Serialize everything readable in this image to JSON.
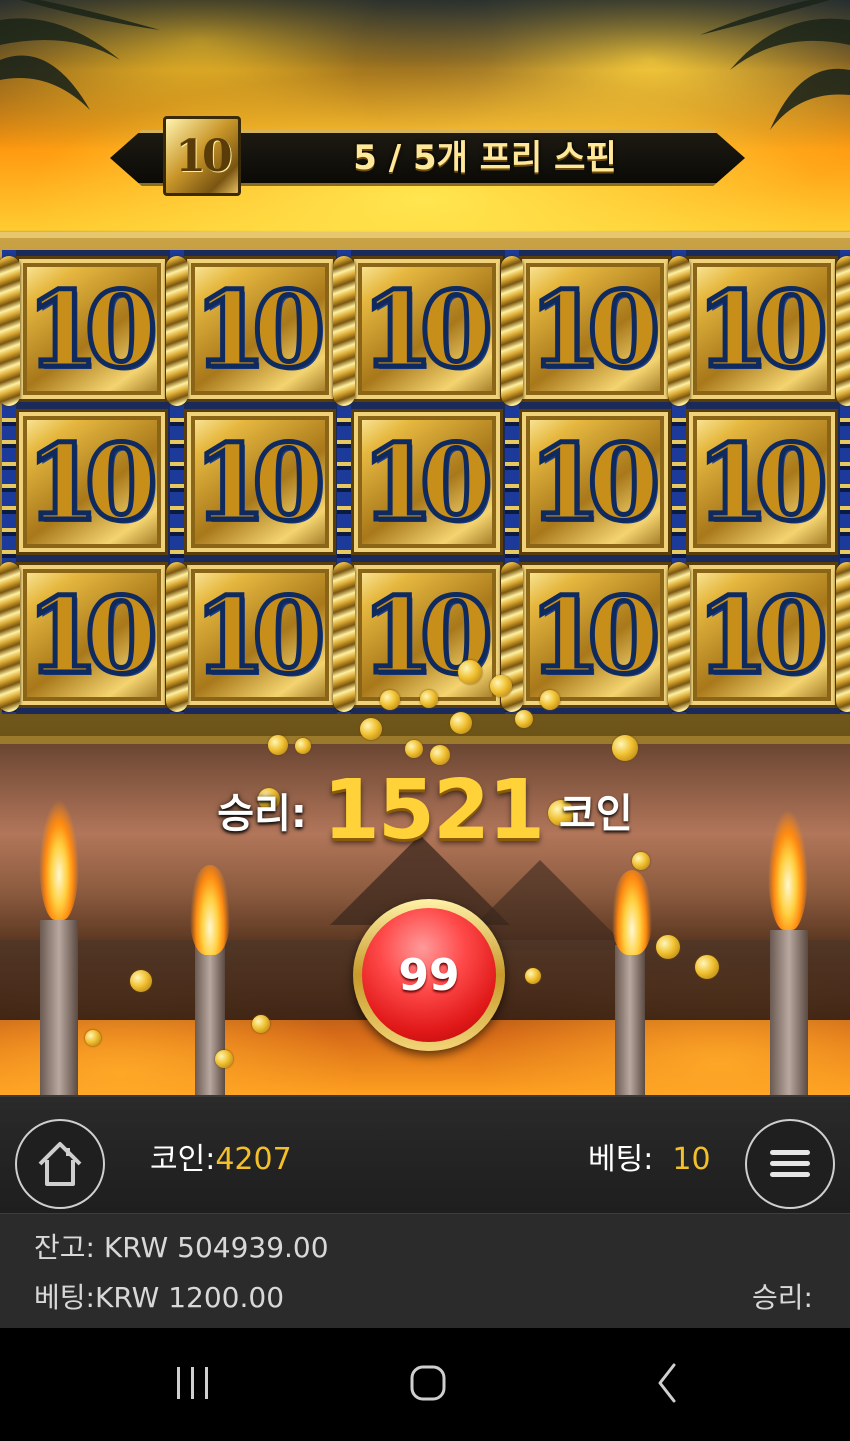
{
  "header": {
    "badge": "10",
    "free_spins": "5 / 5개 프리 스핀"
  },
  "reels": {
    "symbol": "10",
    "rows": 3,
    "cols": 5,
    "symbol_name": "ten-symbol"
  },
  "win": {
    "label": "승리:",
    "amount": "1521",
    "unit": "코인"
  },
  "spin_button": {
    "count": "99"
  },
  "controls": {
    "home_icon": "home-icon",
    "menu_icon": "hamburger-menu-icon",
    "coins_label": "코인:",
    "coins_value": "4207",
    "bet_label": "베팅:",
    "bet_value": "10"
  },
  "info": {
    "balance_label": "잔고:",
    "balance_value": "KRW 504939.00",
    "bet_label": "베팅:",
    "bet_value": "KRW 1200.00",
    "win_label": "승리:"
  },
  "colors": {
    "accent_gold": "#f3c02a",
    "spin_red": "#e01818",
    "bar_bg": "#2b2b2b"
  },
  "system_nav": [
    "recents-icon",
    "home-icon",
    "back-icon"
  ]
}
